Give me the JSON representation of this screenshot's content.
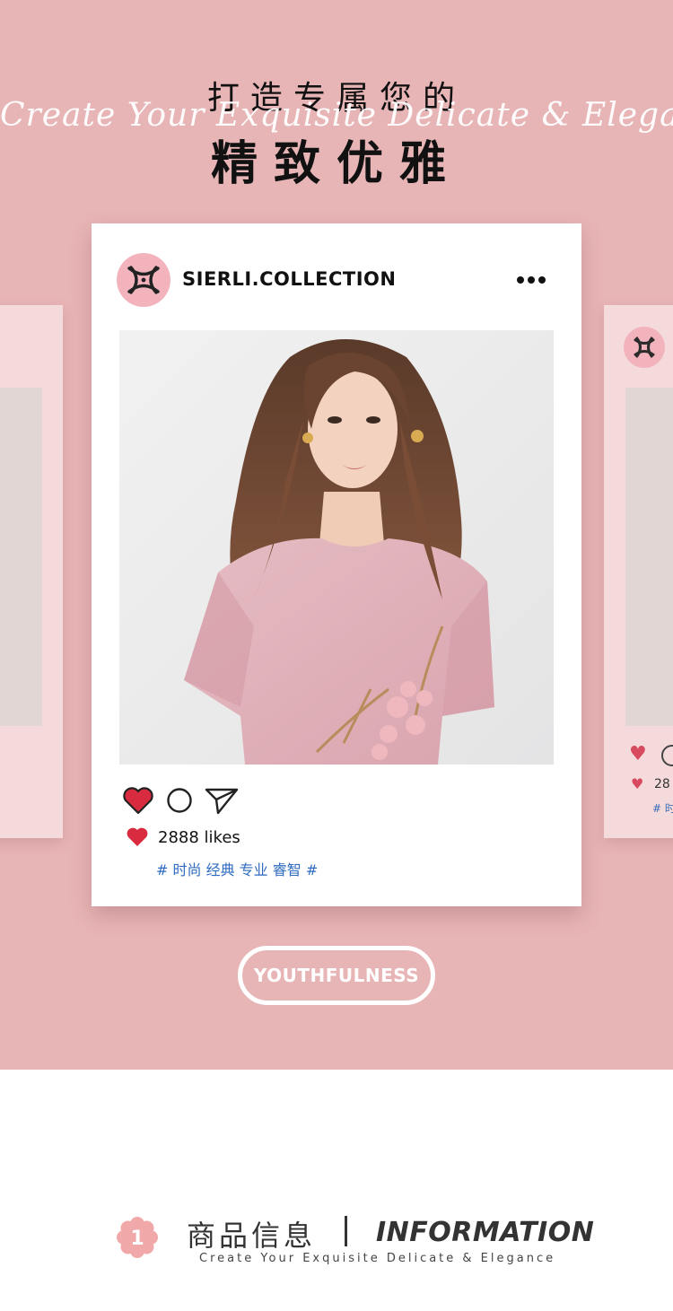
{
  "hero": {
    "title_line1": "打造专属您的",
    "script_line": "Create Your Exquisite Delicate & Elegance",
    "title_line2": "精致优雅",
    "background_color": "#e8b5b7"
  },
  "post": {
    "account_handle": "SIERLI.COLLECTION",
    "more_icon": "more-dots-icon",
    "likes_text": "2888 likes",
    "hashtags": "# 时尚 经典 专业 睿智 #",
    "heart_color": "#d92b3f",
    "hashtag_color": "#2f6bbf"
  },
  "ghost_card": {
    "likes_text": "28",
    "tag_text": "# 时"
  },
  "cta": {
    "label": "YOUTHFULNESS"
  },
  "info_section": {
    "badge_number": "1",
    "title_cn": "商品信息",
    "title_en": "INFORMATION",
    "subtitle": "Create Your Exquisite Delicate & Elegance",
    "accent_color": "#f0a9a8"
  }
}
